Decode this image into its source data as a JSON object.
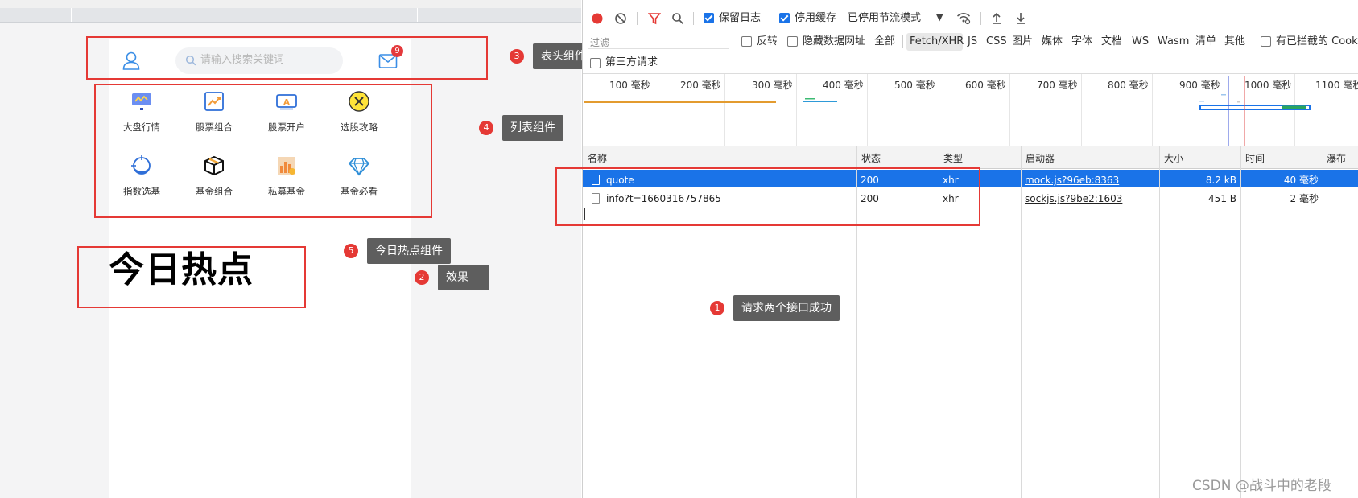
{
  "preview": {
    "search_placeholder": "请输入搜索关键词",
    "mail_badge": "9",
    "grid_items": [
      {
        "label": "大盘行情",
        "icon": "market-chart-icon"
      },
      {
        "label": "股票组合",
        "icon": "stock-trend-icon"
      },
      {
        "label": "股票开户",
        "icon": "account-ticket-icon"
      },
      {
        "label": "选股攻略",
        "icon": "strategy-coin-icon"
      },
      {
        "label": "指数选基",
        "icon": "index-target-icon"
      },
      {
        "label": "基金组合",
        "icon": "fund-box-icon"
      },
      {
        "label": "私募基金",
        "icon": "private-fund-icon"
      },
      {
        "label": "基金必看",
        "icon": "diamond-icon"
      }
    ],
    "hot_title": "今日热点"
  },
  "callouts": [
    {
      "num": "1",
      "text": "请求两个接口成功"
    },
    {
      "num": "2",
      "text": "效果"
    },
    {
      "num": "3",
      "text": "表头组件"
    },
    {
      "num": "4",
      "text": "列表组件"
    },
    {
      "num": "5",
      "text": "今日热点组件"
    }
  ],
  "devtools": {
    "toolbar": {
      "preserve_log": "保留日志",
      "preserve_log_checked": true,
      "disable_cache": "停用缓存",
      "disable_cache_checked": true,
      "throttling": "已停用节流模式"
    },
    "filter": {
      "placeholder": "过滤",
      "invert": "反转",
      "hide_data_urls": "隐藏数据网址",
      "types": [
        "全部",
        "Fetch/XHR",
        "JS",
        "CSS",
        "图片",
        "媒体",
        "字体",
        "文档",
        "WS",
        "Wasm",
        "清单",
        "其他"
      ],
      "active_type": "Fetch/XHR",
      "blocked_cookies": "有已拦截的 Cooki",
      "third_party": "第三方请求"
    },
    "timeline_ticks": [
      "100 毫秒",
      "200 毫秒",
      "300 毫秒",
      "400 毫秒",
      "500 毫秒",
      "600 毫秒",
      "700 毫秒",
      "800 毫秒",
      "900 毫秒",
      "1000 毫秒",
      "1100 毫秒"
    ],
    "columns": [
      "名称",
      "状态",
      "类型",
      "启动器",
      "大小",
      "时间",
      "瀑布"
    ],
    "rows": [
      {
        "name": "quote",
        "status": "200",
        "type": "xhr",
        "initiator": "mock.js?96eb:8363",
        "size": "8.2 kB",
        "time": "40 毫秒",
        "selected": true
      },
      {
        "name": "info?t=1660316757865",
        "status": "200",
        "type": "xhr",
        "initiator": "sockjs.js?9be2:1603",
        "size": "451 B",
        "time": "2 毫秒",
        "selected": false
      }
    ]
  },
  "watermark": "CSDN @战斗中的老段",
  "colors": {
    "accent": "#1a73e8",
    "annotation_red": "#e53935",
    "callout_bg": "#5e5e5e"
  }
}
